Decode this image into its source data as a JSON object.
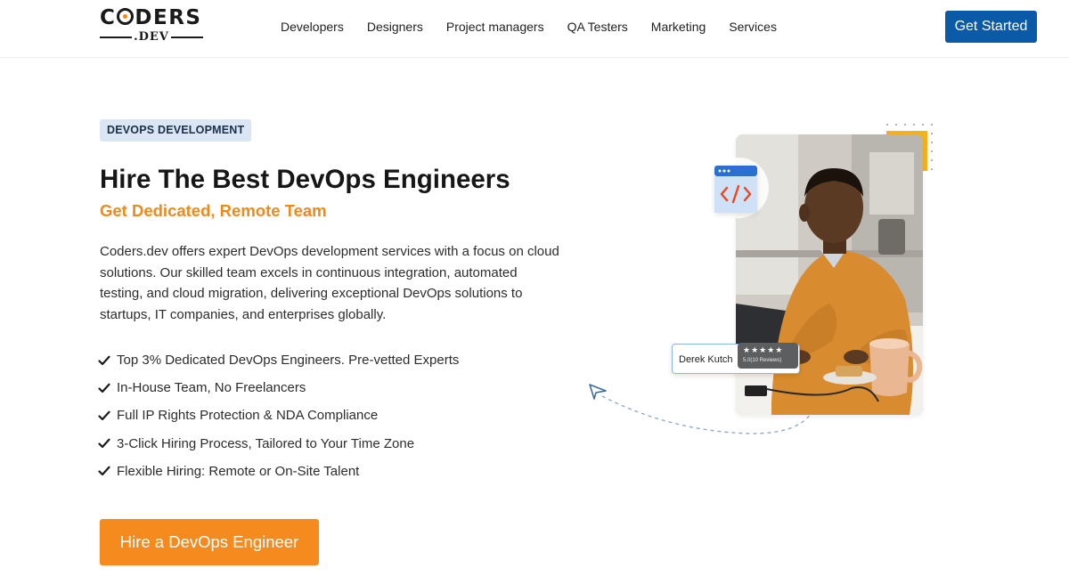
{
  "header": {
    "logo": {
      "main_pre": "C",
      "main_post": "DERS",
      "sub": ".DEV"
    },
    "nav": [
      "Developers",
      "Designers",
      "Project managers",
      "QA Testers",
      "Marketing",
      "Services"
    ],
    "cta_label": "Get Started"
  },
  "hero": {
    "badge": "DEVOPS DEVELOPMENT",
    "title": "Hire The Best DevOps Engineers",
    "subtitle": "Get Dedicated, Remote Team",
    "description": "Coders.dev offers expert DevOps development services with a focus on cloud solutions. Our skilled team excels in continuous integration, automated testing, and cloud migration, delivering exceptional DevOps solutions to startups, IT companies, and enterprises globally.",
    "features": [
      "Top 3% Dedicated DevOps Engineers. Pre-vetted Experts",
      "In-House Team, No Freelancers",
      "Full IP Rights Protection & NDA Compliance",
      "3-Click Hiring Process, Tailored to Your Time Zone",
      "Flexible Hiring: Remote or On-Site Talent"
    ],
    "cta_label": "Hire a DevOps Engineer"
  },
  "illustration": {
    "profile_name": "Derek Kutch",
    "stars": "★★★★★",
    "reviews": "5.0(10 Reviews)",
    "rating": 5,
    "icons": [
      "code-icon",
      "send-icon",
      "check-icon"
    ]
  },
  "colors": {
    "primary_blue": "#0a5aa8",
    "accent_orange": "#f58b1e",
    "badge_bg": "#dbe6f5",
    "accent_yellow": "#f5b21a"
  }
}
